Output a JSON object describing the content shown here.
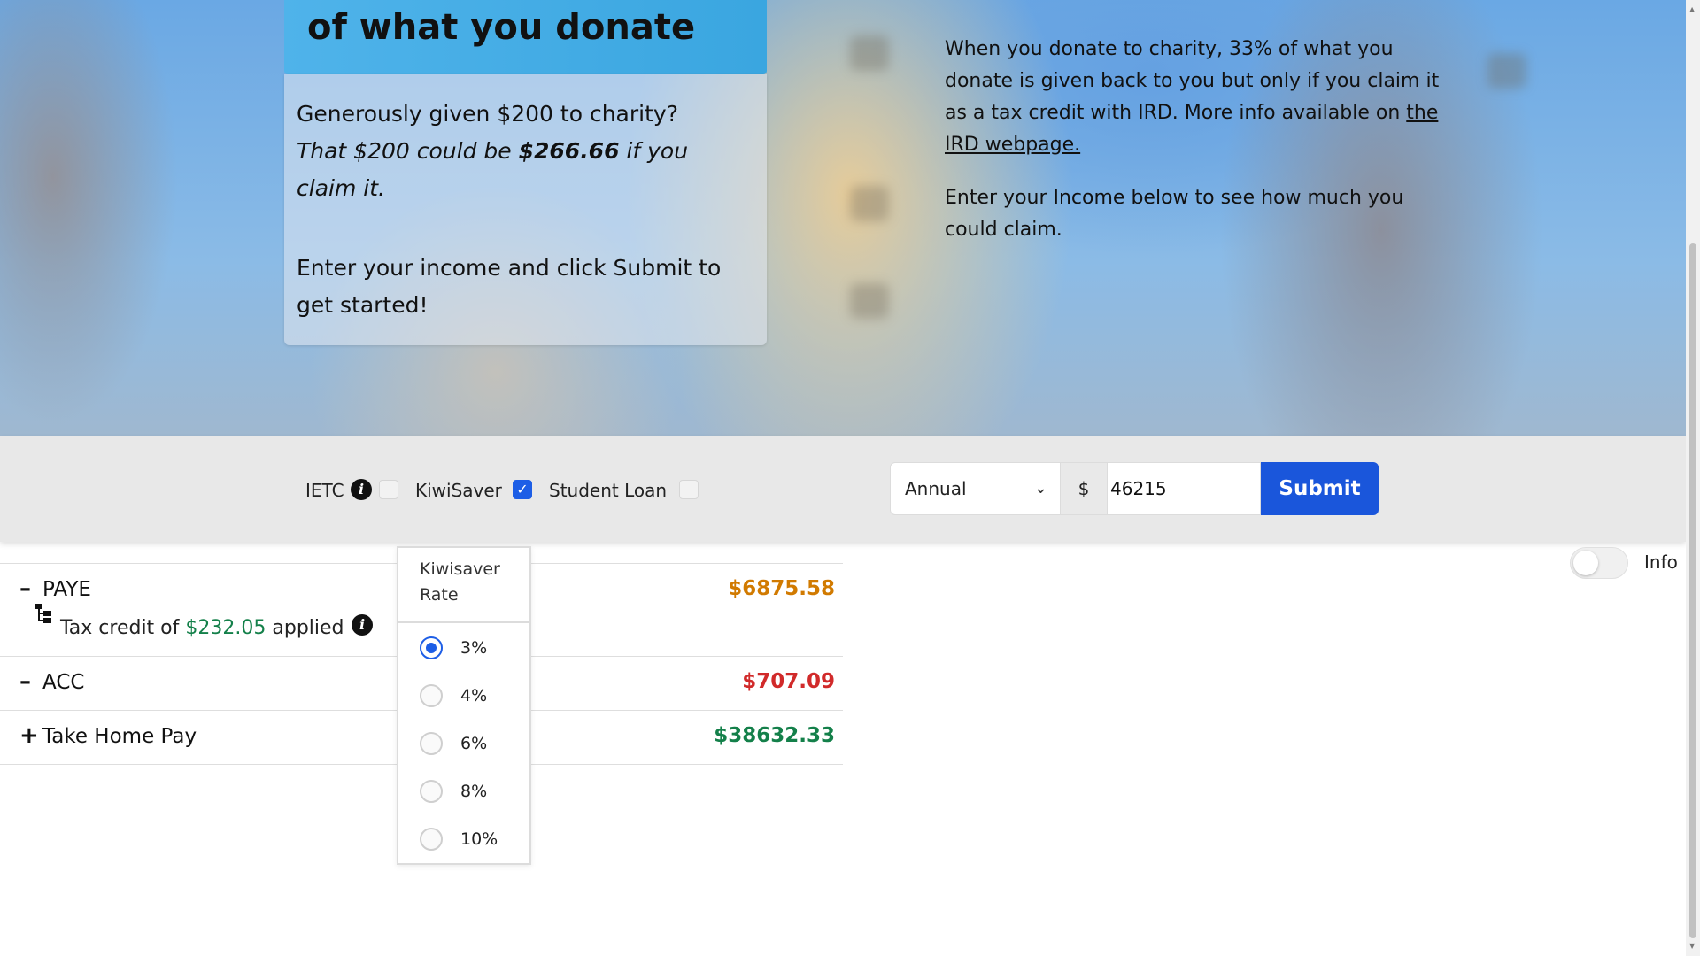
{
  "hero": {
    "card_heading": "of what you donate",
    "card_line1": "Generously given $200 to charity?",
    "card_line2_start": "That $200 could be ",
    "card_line2_bold": "$266.66",
    "card_line2_end": " if you claim it.",
    "card_cta": "Enter your income and click Submit to get started!",
    "info_para_start": "When you donate to charity, 33% of what you donate is given back to you but only if you claim it as a tax credit with IRD. More info available on ",
    "info_link": "the IRD webpage.",
    "info_para2": "Enter your Income below to see how much you could claim."
  },
  "options": {
    "ietc_label": "IETC",
    "ietc_checked": false,
    "kiwisaver_label": "KiwiSaver",
    "kiwisaver_checked": true,
    "student_loan_label": "Student Loan",
    "student_loan_checked": false,
    "info_icon": "info-icon"
  },
  "income_form": {
    "period": "Annual",
    "currency_symbol": "$",
    "income_value": "46215",
    "submit_label": "Submit"
  },
  "results": {
    "paye_label": "PAYE",
    "paye_value": "$6875.58",
    "paye_color": "#d17a00",
    "tax_credit_prefix": "Tax credit of ",
    "tax_credit_amount": "$232.05",
    "tax_credit_suffix": " applied",
    "acc_label": "ACC",
    "acc_value": "$707.09",
    "acc_color": "#d12a2a",
    "take_home_label": "Take Home Pay",
    "take_home_value": "$38632.33",
    "take_home_color": "#14804a",
    "minus_sign": "–",
    "plus_sign": "+"
  },
  "kiwisaver_popover": {
    "title": "Kiwisaver Rate",
    "rates": [
      "3%",
      "4%",
      "6%",
      "8%",
      "10%"
    ],
    "selected": "3%"
  },
  "info_toggle": {
    "label": "Info",
    "on": false
  }
}
